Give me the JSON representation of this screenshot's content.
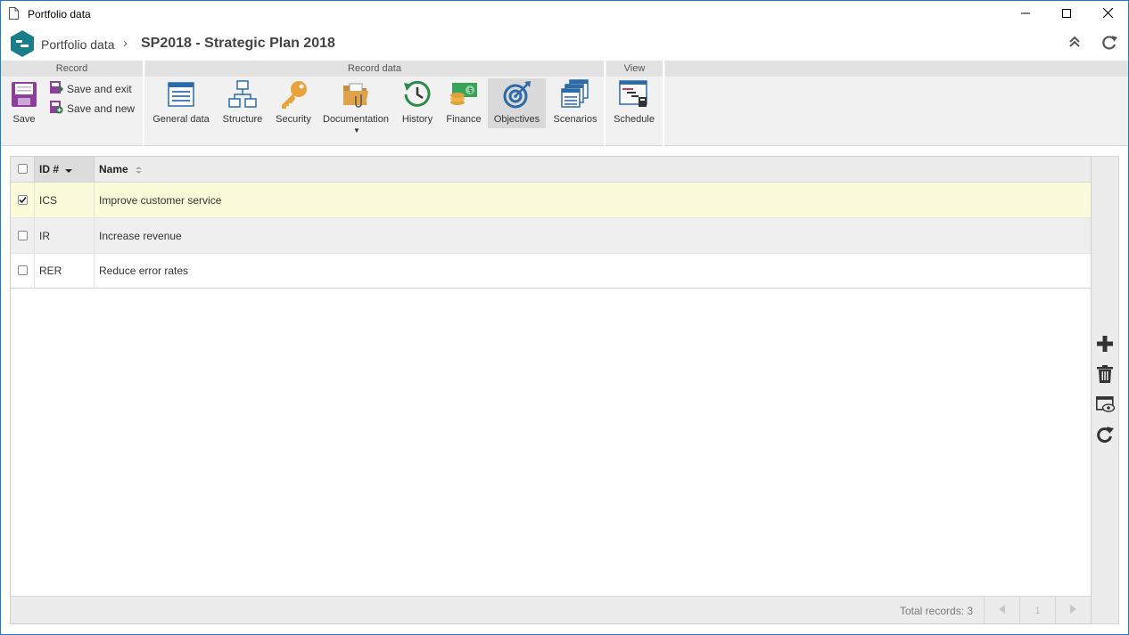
{
  "window": {
    "title": "Portfolio data",
    "minimize_icon": "minimize-icon",
    "maximize_icon": "maximize-icon",
    "close_icon": "close-icon"
  },
  "header": {
    "breadcrumb_parent": "Portfolio data",
    "breadcrumb_separator": "›",
    "record_title": "SP2018 - Strategic Plan 2018",
    "brand_color": "#1b7c8a"
  },
  "ribbon": {
    "groups": [
      {
        "label": "Record"
      },
      {
        "label": "Record data"
      },
      {
        "label": "View"
      }
    ],
    "record": {
      "save_label": "Save",
      "save_exit_label": "Save and exit",
      "save_new_label": "Save and new"
    },
    "record_data": [
      {
        "label": "General data",
        "icon": "general-data-icon"
      },
      {
        "label": "Structure",
        "icon": "structure-icon"
      },
      {
        "label": "Security",
        "icon": "key-icon"
      },
      {
        "label": "Documentation",
        "icon": "folder-icon"
      },
      {
        "label": "History",
        "icon": "history-icon"
      },
      {
        "label": "Finance",
        "icon": "finance-icon"
      },
      {
        "label": "Objectives",
        "icon": "target-icon",
        "active": true
      },
      {
        "label": "Scenarios",
        "icon": "scenarios-icon"
      }
    ],
    "view": [
      {
        "label": "Schedule",
        "icon": "schedule-icon"
      }
    ]
  },
  "grid": {
    "columns": [
      {
        "label": "ID #",
        "sort": "descending"
      },
      {
        "label": "Name",
        "sort": "none"
      }
    ],
    "rows": [
      {
        "id": "ICS",
        "name": "Improve customer service",
        "checked": true
      },
      {
        "id": "IR",
        "name": "Increase revenue",
        "checked": false
      },
      {
        "id": "RER",
        "name": "Reduce error rates",
        "checked": false
      }
    ],
    "footer": {
      "total_records": "Total records: 3",
      "page": "1"
    },
    "selected_row_color": "#fbfbd9"
  },
  "side_toolbar": [
    {
      "icon": "add-icon"
    },
    {
      "icon": "delete-icon"
    },
    {
      "icon": "view-icon"
    },
    {
      "icon": "refresh-icon"
    }
  ]
}
